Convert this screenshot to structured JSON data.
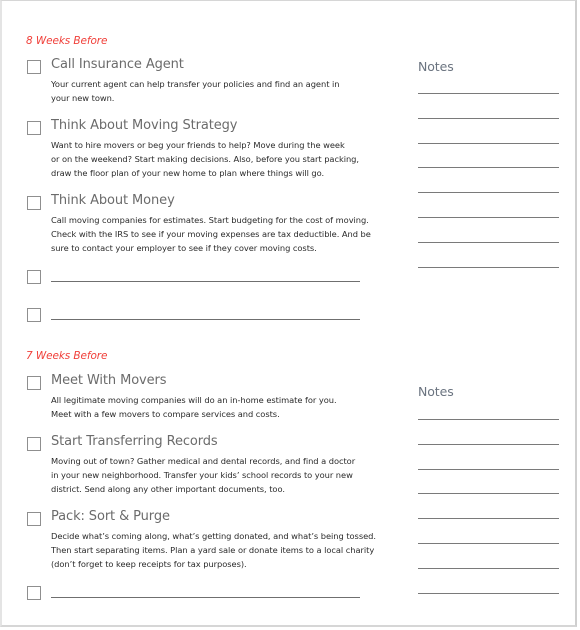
{
  "sections": [
    {
      "heading": "8 Weeks Before",
      "items": [
        {
          "title": "Call Insurance Agent",
          "description": [
            "Your current agent can help transfer your policies and find an agent in",
            "your new town."
          ],
          "checked": false
        },
        {
          "title": "Think About Moving Strategy",
          "description": [
            "Want to hire movers or beg your friends to help? Move during the week",
            "or on the weekend? Start making decisions. Also, before you start packing,",
            "draw the floor plan of your new home to plan where things will go."
          ],
          "checked": false
        },
        {
          "title": "Think About Money",
          "description": [
            "Call moving companies for estimates. Start budgeting for the cost of moving.",
            "Check with the IRS to see if your moving expenses are tax deductible. And be",
            "sure to contact your employer to see if they cover moving costs."
          ],
          "checked": false
        }
      ],
      "blank_items": 2,
      "notes": {
        "title": "Notes",
        "line_count": 8
      }
    },
    {
      "heading": "7 Weeks Before",
      "items": [
        {
          "title": "Meet With Movers",
          "description": [
            "All legitimate moving companies will do an in-home estimate for you.",
            "Meet with a few movers to compare services and costs."
          ],
          "checked": false
        },
        {
          "title": "Start Transferring Records",
          "description": [
            "Moving out of town? Gather medical and dental records, and find a doctor",
            "in your new neighborhood. Transfer your kids’ school records to your new",
            "district. Send along any other important documents, too."
          ],
          "checked": false
        },
        {
          "title": "Pack: Sort & Purge",
          "description": [
            "Decide what’s coming along, what’s getting donated, and what’s being tossed.",
            "Then start separating items. Plan a yard sale or donate items to a local charity",
            "(don’t forget to keep receipts for tax purposes)."
          ],
          "checked": false
        }
      ],
      "blank_items": 1,
      "notes": {
        "title": "Notes",
        "line_count": 8
      }
    }
  ],
  "colors": {
    "heading": "#f0403a",
    "title": "#6b6b6b",
    "body": "#2a2a2a",
    "notes_title": "#6b7480",
    "rule": "#7a7a7a"
  }
}
